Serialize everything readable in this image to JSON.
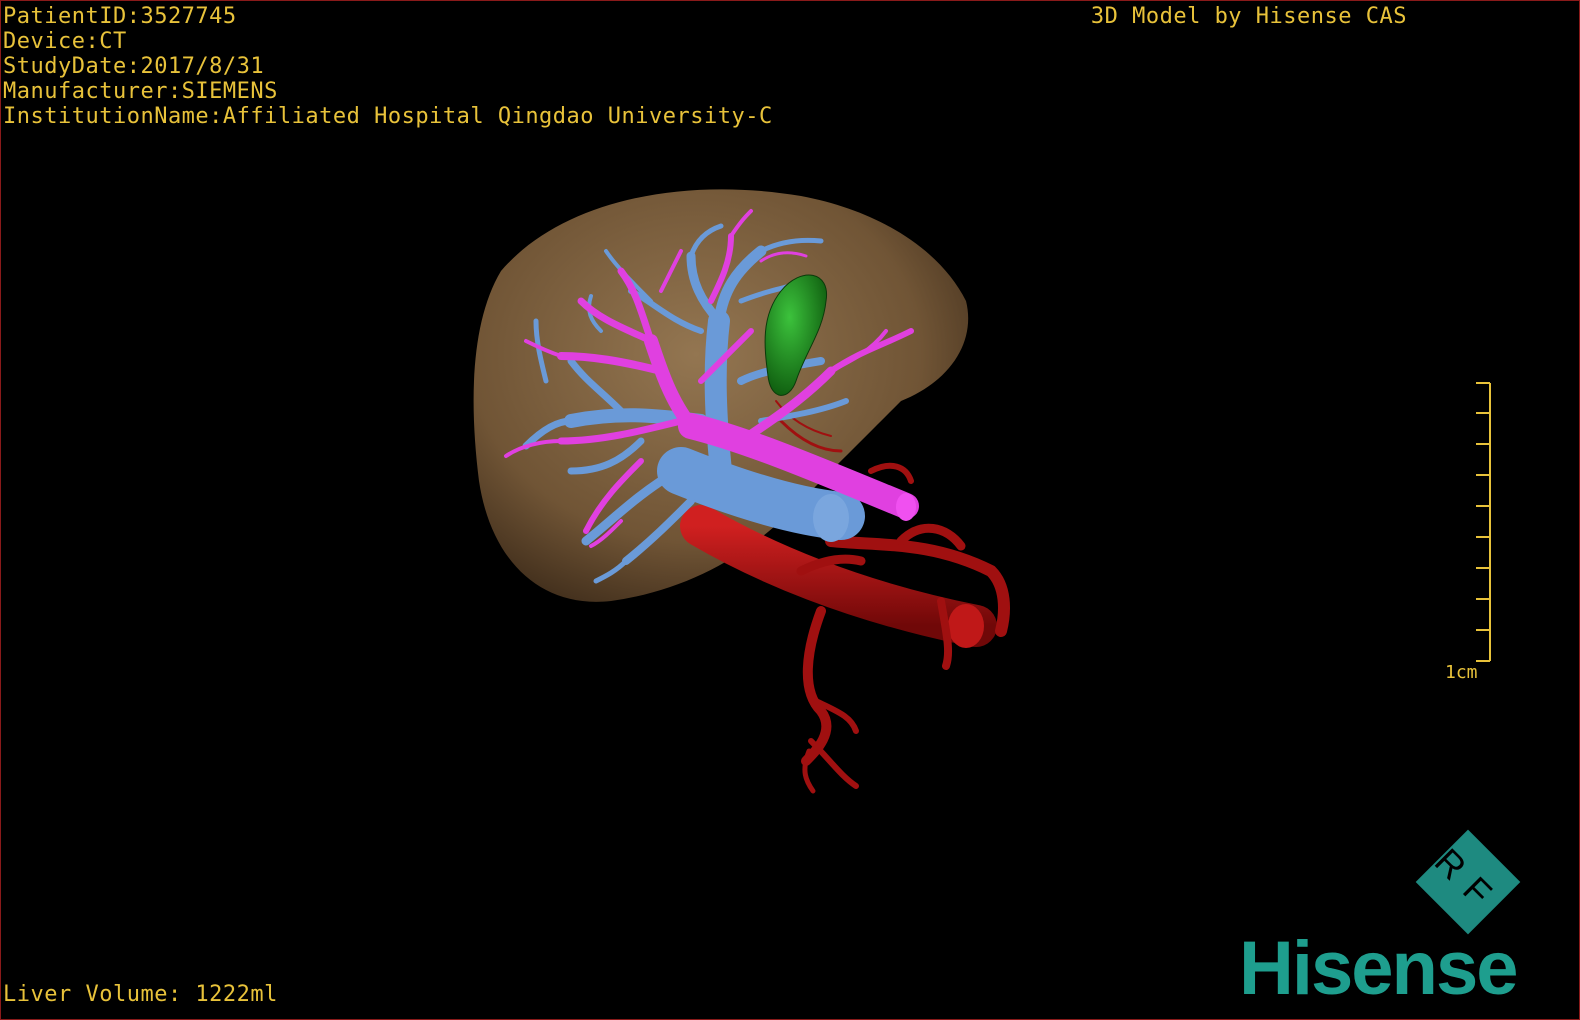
{
  "header": {
    "patient_id": "PatientID:3527745",
    "device": "Device:CT",
    "study_date": "StudyDate:2017/8/31",
    "manufacturer": "Manufacturer:SIEMENS",
    "institution": "InstitutionName:Affiliated Hospital Qingdao University-C",
    "brand_title": "3D Model by Hisense CAS"
  },
  "footer": {
    "liver_volume": "Liver Volume: 1222ml"
  },
  "scale_bar": {
    "label": "1cm"
  },
  "logo": {
    "mark": "RF",
    "wordmark": "Hisense",
    "color": "#1e9e8e"
  },
  "colors": {
    "text": "#e8c23a",
    "liver": "#8a6a45",
    "hepatic_vein": "#6a9ad8",
    "portal_vein": "#e040e0",
    "gallbladder": "#1e8a1e",
    "artery_aorta": "#b01010",
    "frame": "#8a1a1a"
  }
}
